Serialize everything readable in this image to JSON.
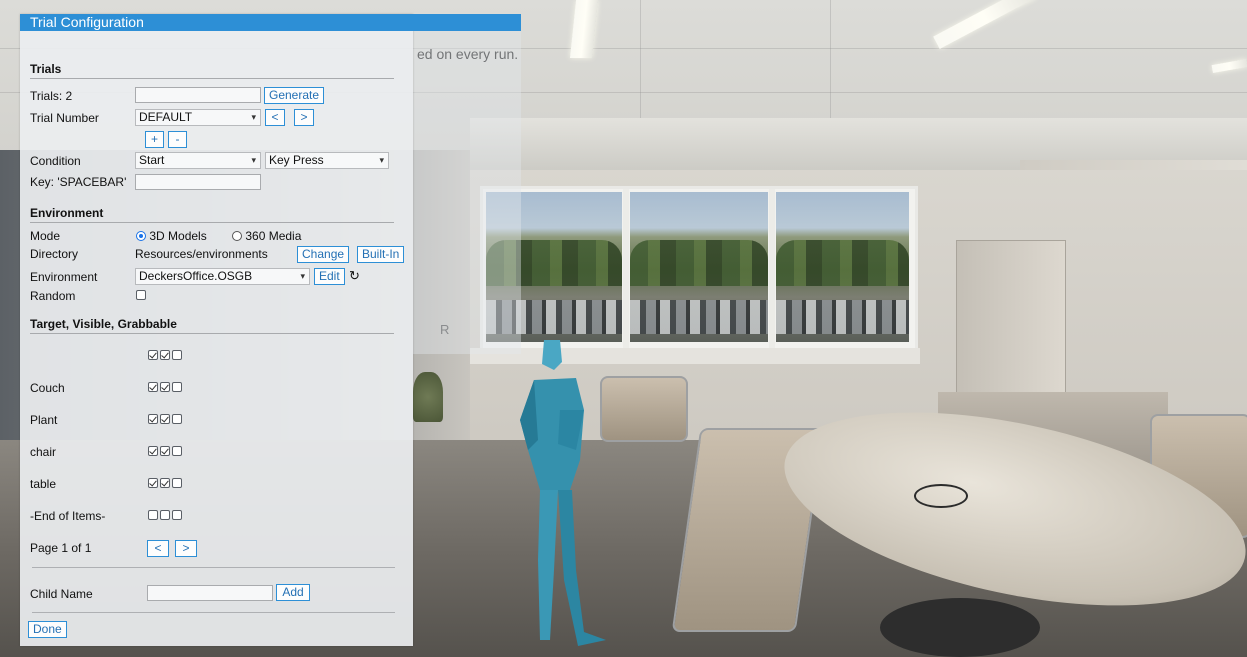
{
  "scene": {
    "run_text": "ed on every run.",
    "marker_label": "R"
  },
  "panel": {
    "title": "Trial Configuration",
    "trials": {
      "section_title": "Trials",
      "trials_label": "Trials: 2",
      "trials_input_value": "",
      "generate_button": "Generate",
      "trial_number_label": "Trial Number",
      "trial_number_value": "DEFAULT",
      "prev_button": "<",
      "next_button": ">",
      "add_button": "+",
      "remove_button": "-",
      "condition_label": "Condition",
      "condition_value": "Start",
      "condition_type_value": "Key Press",
      "key_label": "Key: 'SPACEBAR'",
      "key_input_value": ""
    },
    "environment": {
      "section_title": "Environment",
      "mode_label": "Mode",
      "mode_options": [
        "3D Models",
        "360 Media"
      ],
      "mode_selected": "3D Models",
      "directory_label": "Directory",
      "directory_value": "Resources/environments",
      "change_button": "Change",
      "builtin_button": "Built-In",
      "environment_label": "Environment",
      "environment_value": "DeckersOffice.OSGB",
      "edit_button": "Edit",
      "refresh_icon": "refresh-icon",
      "random_label": "Random",
      "random_checked": false
    },
    "targets": {
      "section_title": "Target, Visible, Grabbable",
      "items": [
        {
          "name": "",
          "target": true,
          "visible": true,
          "grabbable": false
        },
        {
          "name": "Couch",
          "target": true,
          "visible": true,
          "grabbable": false
        },
        {
          "name": "Plant",
          "target": true,
          "visible": true,
          "grabbable": false
        },
        {
          "name": "chair",
          "target": true,
          "visible": true,
          "grabbable": false
        },
        {
          "name": "table",
          "target": true,
          "visible": true,
          "grabbable": false
        },
        {
          "name": "-End of Items-",
          "target": false,
          "visible": false,
          "grabbable": false
        }
      ],
      "page_label": "Page 1 of 1",
      "page_prev": "<",
      "page_next": ">"
    },
    "child": {
      "label": "Child Name",
      "input_value": "",
      "add_button": "Add"
    },
    "done_button": "Done"
  },
  "colors": {
    "accent": "#2d8fd6",
    "panel_bg": "#eceef0"
  }
}
